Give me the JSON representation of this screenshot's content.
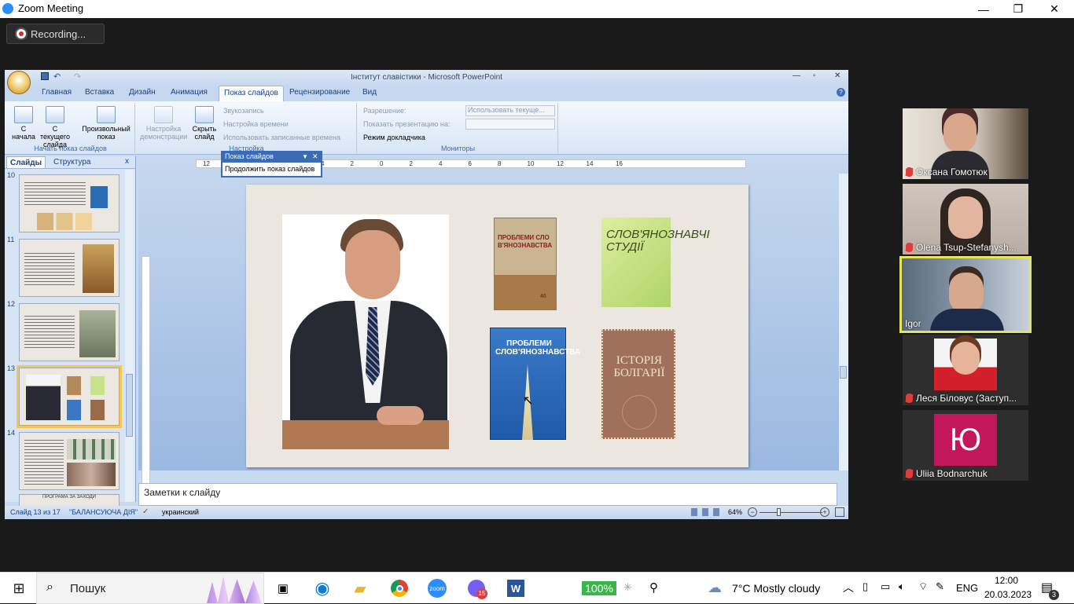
{
  "zoom": {
    "title": "Zoom Meeting",
    "recording_label": "Recording...",
    "window_controls": {
      "minimize": "—",
      "restore": "❐",
      "close": "✕"
    }
  },
  "powerpoint": {
    "title": "Інститут славістики - Microsoft PowerPoint",
    "tabs": [
      "Главная",
      "Вставка",
      "Дизайн",
      "Анимация",
      "Показ слайдов",
      "Рецензирование",
      "Вид"
    ],
    "active_tab": "Показ слайдов",
    "ribbon": {
      "start_group": {
        "label": "Начать показ слайдов",
        "buttons": [
          "С начала",
          "С текущего слайда",
          "Произвольный показ"
        ]
      },
      "setup_group": {
        "label": "Настройка",
        "buttons": [
          "Настройка демонстрации",
          "Скрыть слайд"
        ],
        "items": [
          "Звукозапись",
          "Настройка времени",
          "Использовать записанные времена"
        ]
      },
      "monitors_group": {
        "label": "Мониторы",
        "resolution_label": "Разрешение:",
        "resolution_value": "Использовать текуще...",
        "show_on_label": "Показать презентацию на:",
        "presenter_view": "Режим докладчика"
      }
    },
    "left_pane": {
      "tab_slides": "Слайды",
      "tab_outline": "Структура",
      "close": "x",
      "thumbnails": [
        {
          "num": "10"
        },
        {
          "num": "11"
        },
        {
          "num": "12"
        },
        {
          "num": "13",
          "selected": true
        },
        {
          "num": "14"
        }
      ],
      "partial_thumb_text": "ПРОГРАМА ЗА ЗАХОДИ"
    },
    "slideshow_toolbar": {
      "title": "Показ слайдов",
      "item": "Продолжить показ слайдов"
    },
    "ruler_labels": [
      "12",
      "10",
      "8",
      "6",
      "4",
      "2",
      "0",
      "2",
      "4",
      "6",
      "8",
      "10",
      "12",
      "14",
      "16"
    ],
    "slide": {
      "book1_title": "ПРОБЛЕМИ СЛОВ'ЯНОЗНАВСТВА",
      "book1_num": "46",
      "book2_title": "СЛОВ'ЯНОЗНАВЧІ СТУДІЇ",
      "book3_title": "ПРОБЛЕМИ СЛОВ'ЯНОЗНАВСТВА",
      "book4_title": "ІСТОРІЯ БОЛГАРІЇ"
    },
    "notes_placeholder": "Заметки к слайду",
    "status": {
      "slide_of": "Слайд 13 из 17",
      "theme": "\"БАЛАНСУЮЧА ДІЯ\"",
      "language": "украинский",
      "zoom": "64%"
    }
  },
  "participants": [
    {
      "name": "Оксана Гомотюк",
      "muted": true
    },
    {
      "name": "Olena Tsup-Stefanysh...",
      "muted": true
    },
    {
      "name": "Igor",
      "muted": false,
      "active_speaker": true
    },
    {
      "name": "Леся Біловус (Заступ...",
      "muted": true
    },
    {
      "name": "Uliia Bodnarchuk",
      "muted": true,
      "initial": "Ю"
    }
  ],
  "colors": {
    "active_speaker_border": "#e5e55a",
    "avatar_bg": "#c2185b",
    "zoom_blue": "#2d8cff"
  },
  "taskbar": {
    "search_label": "Пошук",
    "battery": "100%",
    "weather": "7°C  Mostly cloudy",
    "language": "ENG",
    "time": "12:00",
    "date": "20.03.2023",
    "notification_count": "3",
    "viber_badge": "15"
  }
}
